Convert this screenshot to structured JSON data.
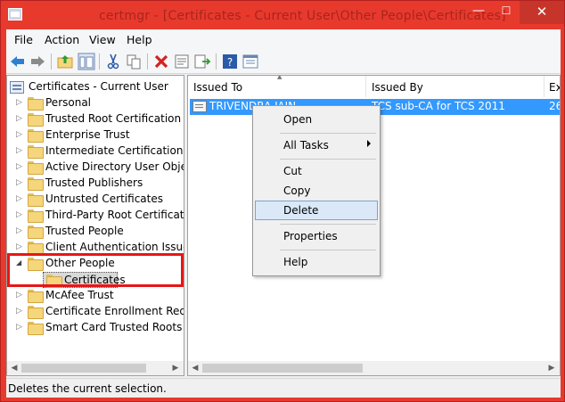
{
  "window": {
    "title": "certmgr - [Certificates - Current User\\Other People\\Certificates]",
    "minimize_glyph": "—",
    "maximize_glyph": "☐",
    "close_glyph": "✕"
  },
  "menubar": {
    "items": [
      "File",
      "Action",
      "View",
      "Help"
    ]
  },
  "toolbar": {
    "icons": [
      "back-arrow-icon",
      "forward-arrow-icon",
      "up-folder-icon",
      "show-hide-tree-icon",
      "cut-icon",
      "copy-icon",
      "delete-icon",
      "properties-icon",
      "export-list-icon",
      "help-icon",
      "view-icon"
    ]
  },
  "tree": {
    "root": "Certificates - Current User",
    "items": [
      {
        "label": "Personal",
        "expander": "▷"
      },
      {
        "label": "Trusted Root Certification Au",
        "expander": "▷"
      },
      {
        "label": "Enterprise Trust",
        "expander": "▷"
      },
      {
        "label": "Intermediate Certification Au",
        "expander": "▷"
      },
      {
        "label": "Active Directory User Object",
        "expander": "▷"
      },
      {
        "label": "Trusted Publishers",
        "expander": "▷"
      },
      {
        "label": "Untrusted Certificates",
        "expander": "▷"
      },
      {
        "label": "Third-Party Root Certification",
        "expander": "▷"
      },
      {
        "label": "Trusted People",
        "expander": "▷"
      },
      {
        "label": "Client Authentication Issuers",
        "expander": "▷"
      },
      {
        "label": "Other People",
        "expander": "◢"
      },
      {
        "label": "Certificates",
        "expander": ""
      },
      {
        "label": "McAfee Trust",
        "expander": "▷"
      },
      {
        "label": "Certificate Enrollment Reque",
        "expander": "▷"
      },
      {
        "label": "Smart Card Trusted Roots",
        "expander": "▷"
      }
    ]
  },
  "list": {
    "columns": [
      "Issued To",
      "Issued By",
      "Ex"
    ],
    "sort_glyph": "▲",
    "rows": [
      {
        "issued_to": "TRIVENDRA JAIN",
        "issued_by": "TCS sub-CA for TCS 2011",
        "expiration": "26"
      }
    ]
  },
  "context_menu": {
    "open": "Open",
    "all_tasks": "All Tasks",
    "cut": "Cut",
    "copy": "Copy",
    "delete": "Delete",
    "properties": "Properties",
    "help": "Help"
  },
  "scrollbar": {
    "left_arrow": "◀",
    "right_arrow": "▶"
  },
  "status": "Deletes the current selection.",
  "colors": {
    "window_frame": "#e8392d",
    "selection": "#3399ff",
    "highlight_box": "#e81616"
  }
}
